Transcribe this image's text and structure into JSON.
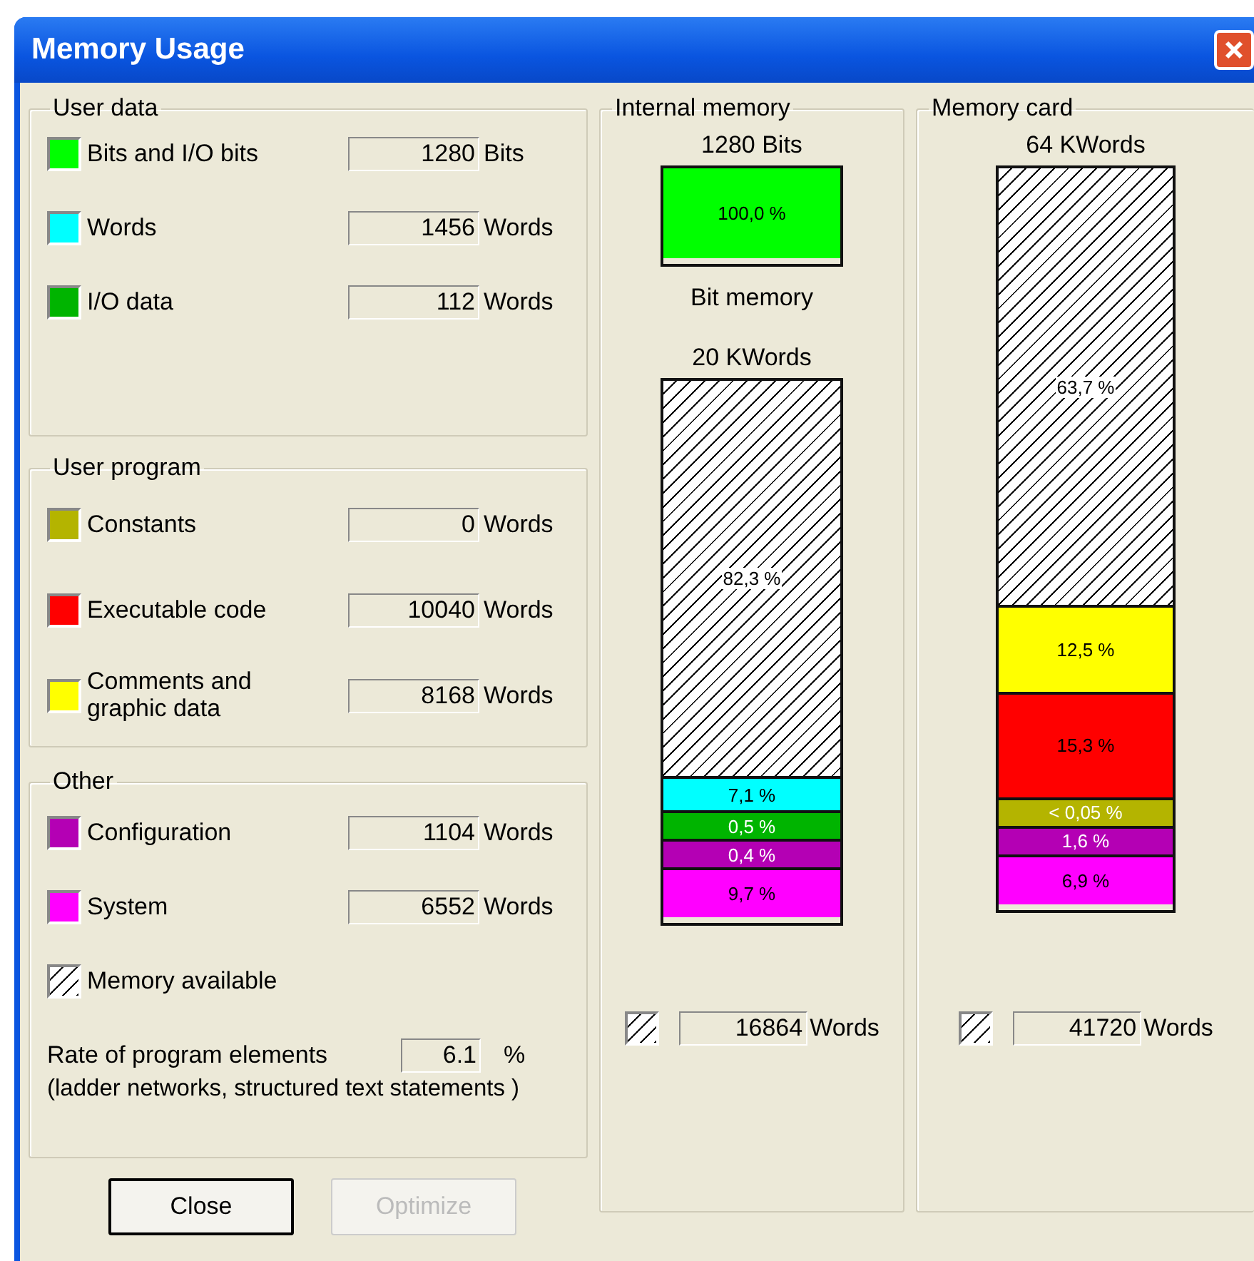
{
  "window": {
    "title": "Memory Usage"
  },
  "groups": [
    {
      "title": "User data",
      "items": [
        {
          "kind": "swatch",
          "color": "#00ff00",
          "label": "Bits and I/O bits",
          "value": "1280",
          "unit": "Bits"
        },
        {
          "kind": "swatch",
          "color": "#00ffff",
          "label": "Words",
          "value": "1456",
          "unit": "Words"
        },
        {
          "kind": "swatch",
          "color": "#00b400",
          "label": "I/O data",
          "value": "112",
          "unit": "Words"
        }
      ]
    },
    {
      "title": "User program",
      "items": [
        {
          "kind": "swatch",
          "color": "#b4b400",
          "label": "Constants",
          "value": "0",
          "unit": "Words"
        },
        {
          "kind": "swatch",
          "color": "#ff0000",
          "label": "Executable code",
          "value": "10040",
          "unit": "Words"
        },
        {
          "kind": "swatch",
          "color": "#ffff00",
          "label": "Comments and\ngraphic data",
          "value": "8168",
          "unit": "Words"
        }
      ]
    },
    {
      "title": "Other",
      "items": [
        {
          "kind": "swatch",
          "color": "#b400b4",
          "label": "Configuration",
          "value": "1104",
          "unit": "Words"
        },
        {
          "kind": "swatch",
          "color": "#ff00ff",
          "label": "System",
          "value": "6552",
          "unit": "Words"
        },
        {
          "kind": "hatch",
          "label": "Memory available"
        },
        {
          "kind": "rate",
          "label": "Rate of program elements",
          "value": "6.1",
          "unit": "%",
          "note": "(ladder networks, structured text statements )"
        }
      ]
    }
  ],
  "panels": [
    {
      "title": "Internal memory",
      "blocks": [
        {
          "caption": "1280 Bits",
          "footer": "Bit memory",
          "segments": [
            {
              "kind": "used",
              "color": "#00ff00",
              "label": "100,0 %",
              "inverse": false
            }
          ]
        },
        {
          "caption": "20 KWords",
          "segments": [
            {
              "kind": "available",
              "label": "82,3 %",
              "inverse": false
            },
            {
              "kind": "used",
              "color": "#00ffff",
              "label": "7,1 %",
              "inverse": false
            },
            {
              "kind": "used",
              "color": "#00b400",
              "label": "0,5 %",
              "inverse": true
            },
            {
              "kind": "used",
              "color": "#b400b4",
              "label": "0,4 %",
              "inverse": true
            },
            {
              "kind": "used",
              "color": "#ff00ff",
              "label": "9,7 %",
              "inverse": false
            }
          ]
        }
      ],
      "available": {
        "value": "16864",
        "unit": "Words"
      }
    },
    {
      "title": "Memory card",
      "blocks": [
        {
          "caption": "64 KWords",
          "segments": [
            {
              "kind": "available",
              "label": "63,7 %",
              "inverse": false
            },
            {
              "kind": "used",
              "color": "#ffff00",
              "label": "12,5 %",
              "inverse": false
            },
            {
              "kind": "used",
              "color": "#ff0000",
              "label": "15,3 %",
              "inverse": false
            },
            {
              "kind": "used",
              "color": "#b4b400",
              "label": "< 0,05 %",
              "inverse": true
            },
            {
              "kind": "used",
              "color": "#b400b4",
              "label": "1,6 %",
              "inverse": true
            },
            {
              "kind": "used",
              "color": "#ff00ff",
              "label": "6,9 %",
              "inverse": false
            }
          ]
        }
      ],
      "available": {
        "value": "41720",
        "unit": "Words"
      }
    }
  ],
  "buttons": [
    {
      "label": "Close",
      "disabled": false
    },
    {
      "label": "Optimize",
      "disabled": true
    }
  ]
}
